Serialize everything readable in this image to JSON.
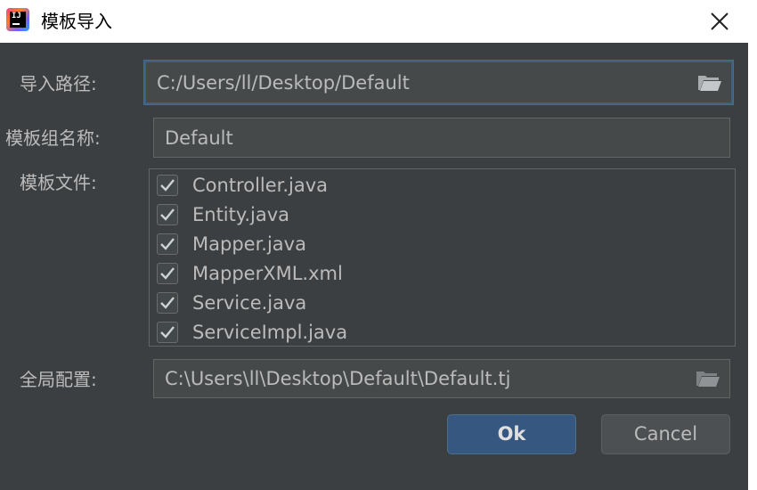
{
  "window": {
    "title": "模板导入",
    "app_icon": "intellij-idea-icon",
    "app_icon_text": "IJ",
    "close_icon": "close-icon"
  },
  "form": {
    "import_path_label": "导入路径:",
    "import_path_value": "C:/Users/ll/Desktop/Default",
    "group_name_label": "模板组名称:",
    "group_name_value": "Default",
    "template_files_label": "模板文件:",
    "template_files": [
      {
        "name": "Controller.java",
        "checked": true
      },
      {
        "name": "Entity.java",
        "checked": true
      },
      {
        "name": "Mapper.java",
        "checked": true
      },
      {
        "name": "MapperXML.xml",
        "checked": true
      },
      {
        "name": "Service.java",
        "checked": true
      },
      {
        "name": "ServiceImpl.java",
        "checked": true
      }
    ],
    "global_config_label": "全局配置:",
    "global_config_value": "C:\\Users\\ll\\Desktop\\Default\\Default.tj"
  },
  "buttons": {
    "ok_label": "Ok",
    "cancel_label": "Cancel"
  },
  "colors": {
    "dialog_bg": "#3c3f41",
    "field_bg": "#45494a",
    "focus_border": "#3d6185",
    "primary_button": "#365880",
    "text": "#bbbbbb"
  }
}
